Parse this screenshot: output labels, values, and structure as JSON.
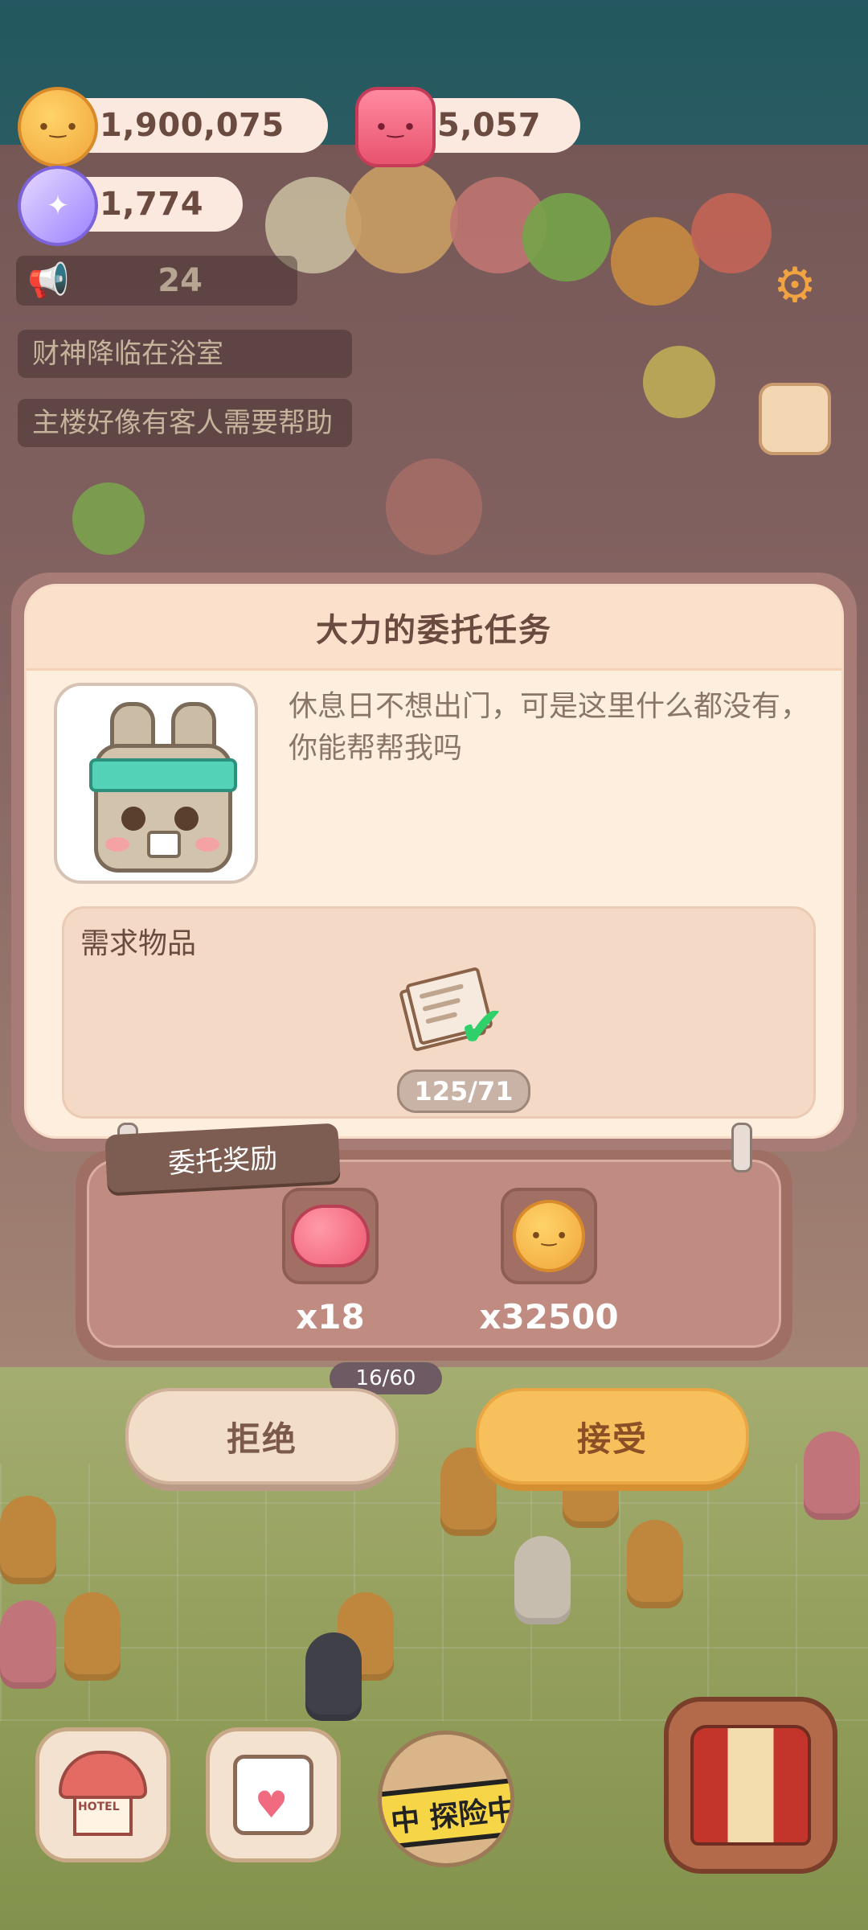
{
  "hud": {
    "cookies": "1,900,075",
    "jam": "5,057",
    "candy": "1,774",
    "notice_count": "24",
    "messages": [
      "财神降临在浴室",
      "主楼好像有客人需要帮助"
    ]
  },
  "dialog": {
    "title": "大力的委托任务",
    "description": "休息日不想出门，可是这里什么都没有，你能帮帮我吗",
    "requirement_title": "需求物品",
    "item_count": "125/71"
  },
  "reward": {
    "tag": "委托奖励",
    "items": [
      {
        "icon": "heart-icon",
        "qty": "x18"
      },
      {
        "icon": "cookie-icon",
        "qty": "x32500"
      }
    ]
  },
  "buttons": {
    "reject": "拒绝",
    "accept": "接受"
  },
  "scene": {
    "progress": "16/60"
  },
  "nav": {
    "hotel_label": "HOTEL",
    "adventure_label": "中 探险中"
  }
}
